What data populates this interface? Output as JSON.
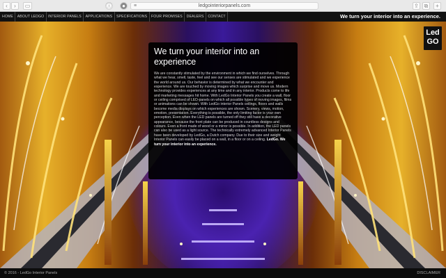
{
  "browser": {
    "url": "ledgointeriorpanels.com"
  },
  "nav": {
    "items": [
      {
        "label": "HOME"
      },
      {
        "label": "ABOUT LEDGO"
      },
      {
        "label": "INTERIOR PANELS"
      },
      {
        "label": "APPLICATIONS"
      },
      {
        "label": "SPECIFICATIONS"
      },
      {
        "label": "FOUR PROMISES"
      },
      {
        "label": "DEALERS"
      },
      {
        "label": "CONTACT"
      }
    ],
    "tagline": "We turn your interior into an experience."
  },
  "logo": {
    "line1": "Led",
    "line2": "GO"
  },
  "panel": {
    "title": "We turn your interior into an experience",
    "body": "We are constantly stimulated by the environment in which we find ourselves. Through what we hear, smell, taste, feel and see our senses are stimulated and we experience the world around us. Our behavior is determined by what we encounter and experience. We are touched by moving images which surprise and move us. Modern technology provides experiences at any time and in any interior. Products come to life and marketing messages hit home. With LedGo Interior Panels you create a wall, floor or ceiling comprised of LED-panels on which all possible types of moving images, films or animations can be shown. With LedGo interior Panels ceilings, floors and walls become media displays on which experiences are shown. Scenery, views, motion, emotion, presentation. Everything is possible, the only limiting factor is your own perception. Even when the LED panels are turned off they still have a decorative appearance, because the front plate can be produced in countless designs and colours. Even a front made of wood or a mirror is possible. In addition, the LED panels can also be used as a light source. The technically extremely advanced Interior Panels have been developed by LedGo, a Dutch company. Due to their size and weight Interior Panels can easily be placed on a wall, in a floor or on a ceiling. ",
    "body_strong": "LedGo. We turn your interior into an experience."
  },
  "footer": {
    "copyright": "© 2016 - LedGo Interior Panels",
    "disclaimer": "DISCLAIMER"
  },
  "colors": {
    "gold": "#e7b12a",
    "violet": "#3a1a9a",
    "panel_bg": "#000000"
  }
}
